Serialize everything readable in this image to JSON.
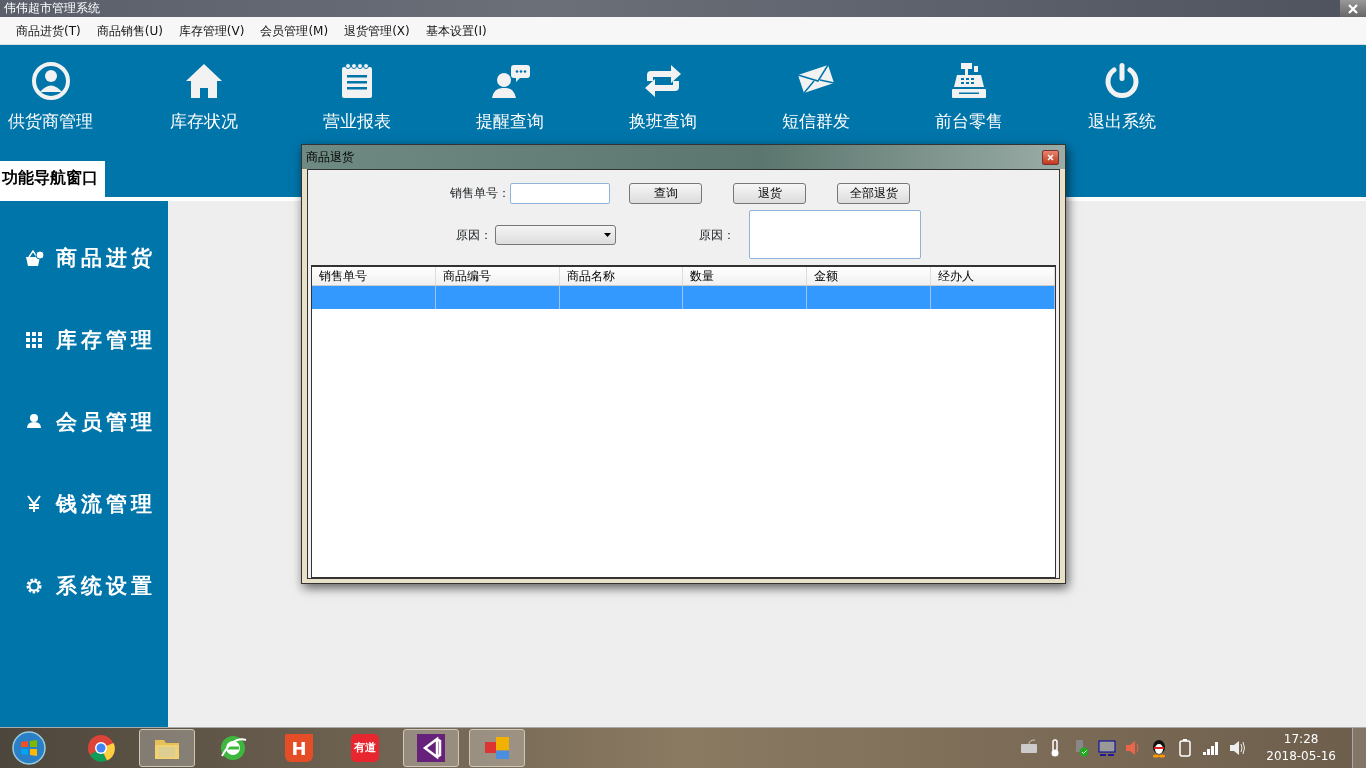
{
  "app_title": "伟伟超市管理系统",
  "menu": [
    {
      "label": "商品进货(T)"
    },
    {
      "label": "商品销售(U)"
    },
    {
      "label": "库存管理(V)"
    },
    {
      "label": "会员管理(M)"
    },
    {
      "label": "退货管理(X)"
    },
    {
      "label": "基本设置(I)"
    }
  ],
  "toolbar": [
    {
      "label": "供货商管理",
      "kind": "person"
    },
    {
      "label": "库存状况",
      "kind": "house"
    },
    {
      "label": "营业报表",
      "kind": "notepad"
    },
    {
      "label": "提醒查询",
      "kind": "chat"
    },
    {
      "label": "换班查询",
      "kind": "swap"
    },
    {
      "label": "短信群发",
      "kind": "mail"
    },
    {
      "label": "前台零售",
      "kind": "register"
    },
    {
      "label": "退出系统",
      "kind": "power"
    }
  ],
  "nav_tab": {
    "label": "功能导航窗口"
  },
  "sidebar": [
    {
      "label": "商品进货",
      "kind": "basket"
    },
    {
      "label": "库存管理",
      "kind": "grid"
    },
    {
      "label": "会员管理",
      "kind": "user"
    },
    {
      "label": "钱流管理",
      "kind": "yen"
    },
    {
      "label": "系统设置",
      "kind": "gear"
    }
  ],
  "dialog": {
    "title": "商品退货",
    "order_label": "销售单号：",
    "buttons": [
      {
        "label": "查询"
      },
      {
        "label": "退货"
      },
      {
        "label": "全部退货"
      }
    ],
    "reason_select_label": "原因：",
    "reason_text_label": "原因：",
    "table": {
      "columns": [
        "销售单号",
        "商品编号",
        "商品名称",
        "数量",
        "金额",
        "经办人"
      ],
      "rows": [
        {
          "selected": true
        }
      ]
    }
  },
  "taskbar": {
    "apps": [
      {
        "kind": "chrome",
        "active": false
      },
      {
        "kind": "folder",
        "active": true
      },
      {
        "kind": "ie",
        "active": false
      },
      {
        "kind": "html",
        "active": false,
        "text": "H"
      },
      {
        "kind": "youdao",
        "active": false,
        "text": "有道"
      },
      {
        "kind": "vs",
        "active": true
      },
      {
        "kind": "app",
        "active": true
      }
    ],
    "tray": [
      {
        "kind": "keyboard"
      },
      {
        "kind": "thermometer"
      },
      {
        "kind": "usb"
      },
      {
        "kind": "monitor"
      },
      {
        "kind": "speaker"
      },
      {
        "kind": "penguin"
      },
      {
        "kind": "battery"
      },
      {
        "kind": "signal"
      },
      {
        "kind": "volume"
      }
    ],
    "time": "17:28",
    "date": "2018-05-16"
  }
}
